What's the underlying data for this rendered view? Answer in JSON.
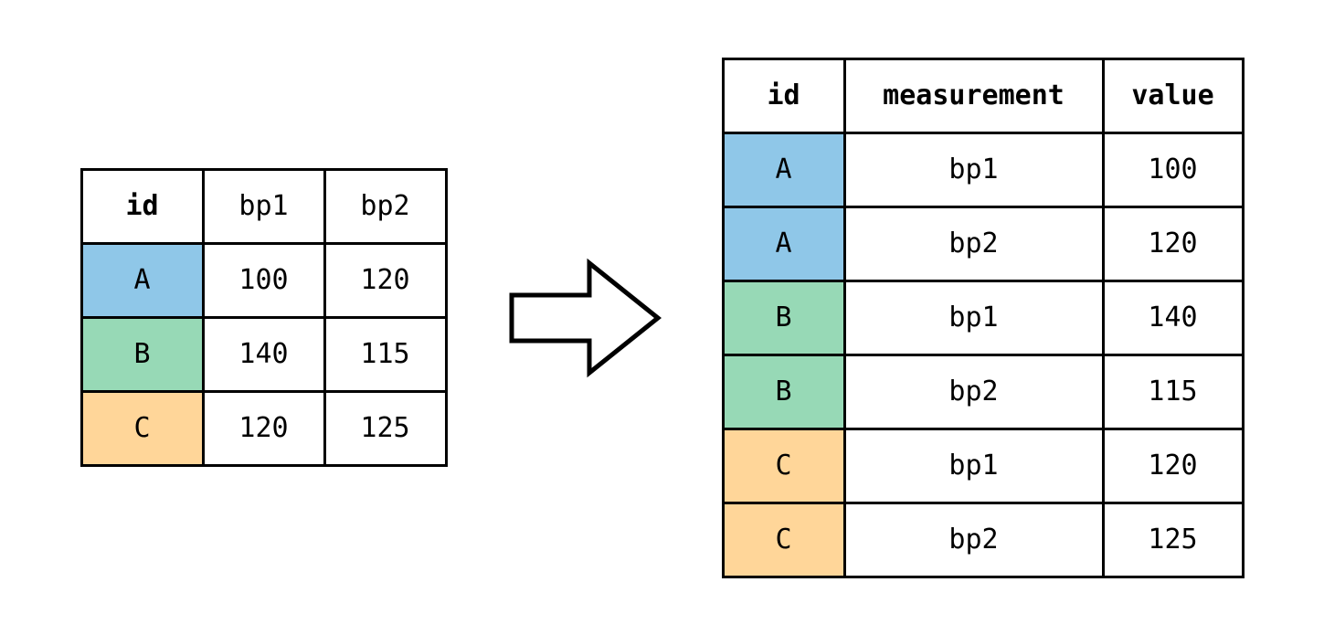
{
  "colors": {
    "a": "#8fc7e8",
    "b": "#97d9b6",
    "c": "#ffd699"
  },
  "wide_table": {
    "headers": {
      "id": "id",
      "bp1": "bp1",
      "bp2": "bp2"
    },
    "rows": [
      {
        "id": "A",
        "bp1": "100",
        "bp2": "120",
        "color": "a"
      },
      {
        "id": "B",
        "bp1": "140",
        "bp2": "115",
        "color": "b"
      },
      {
        "id": "C",
        "bp1": "120",
        "bp2": "125",
        "color": "c"
      }
    ]
  },
  "long_table": {
    "headers": {
      "id": "id",
      "measurement": "measurement",
      "value": "value"
    },
    "rows": [
      {
        "id": "A",
        "measurement": "bp1",
        "value": "100",
        "color": "a"
      },
      {
        "id": "A",
        "measurement": "bp2",
        "value": "120",
        "color": "a"
      },
      {
        "id": "B",
        "measurement": "bp1",
        "value": "140",
        "color": "b"
      },
      {
        "id": "B",
        "measurement": "bp2",
        "value": "115",
        "color": "b"
      },
      {
        "id": "C",
        "measurement": "bp1",
        "value": "120",
        "color": "c"
      },
      {
        "id": "C",
        "measurement": "bp2",
        "value": "125",
        "color": "c"
      }
    ]
  },
  "chart_data": {
    "type": "table",
    "description": "Wide-to-long (pivot_longer) reshape illustration",
    "wide": {
      "columns": [
        "id",
        "bp1",
        "bp2"
      ],
      "rows": [
        {
          "id": "A",
          "bp1": 100,
          "bp2": 120
        },
        {
          "id": "B",
          "bp1": 140,
          "bp2": 115
        },
        {
          "id": "C",
          "bp1": 120,
          "bp2": 125
        }
      ]
    },
    "long": {
      "columns": [
        "id",
        "measurement",
        "value"
      ],
      "rows": [
        {
          "id": "A",
          "measurement": "bp1",
          "value": 100
        },
        {
          "id": "A",
          "measurement": "bp2",
          "value": 120
        },
        {
          "id": "B",
          "measurement": "bp1",
          "value": 140
        },
        {
          "id": "B",
          "measurement": "bp2",
          "value": 115
        },
        {
          "id": "C",
          "measurement": "bp1",
          "value": 120
        },
        {
          "id": "C",
          "measurement": "bp2",
          "value": 125
        }
      ]
    }
  }
}
